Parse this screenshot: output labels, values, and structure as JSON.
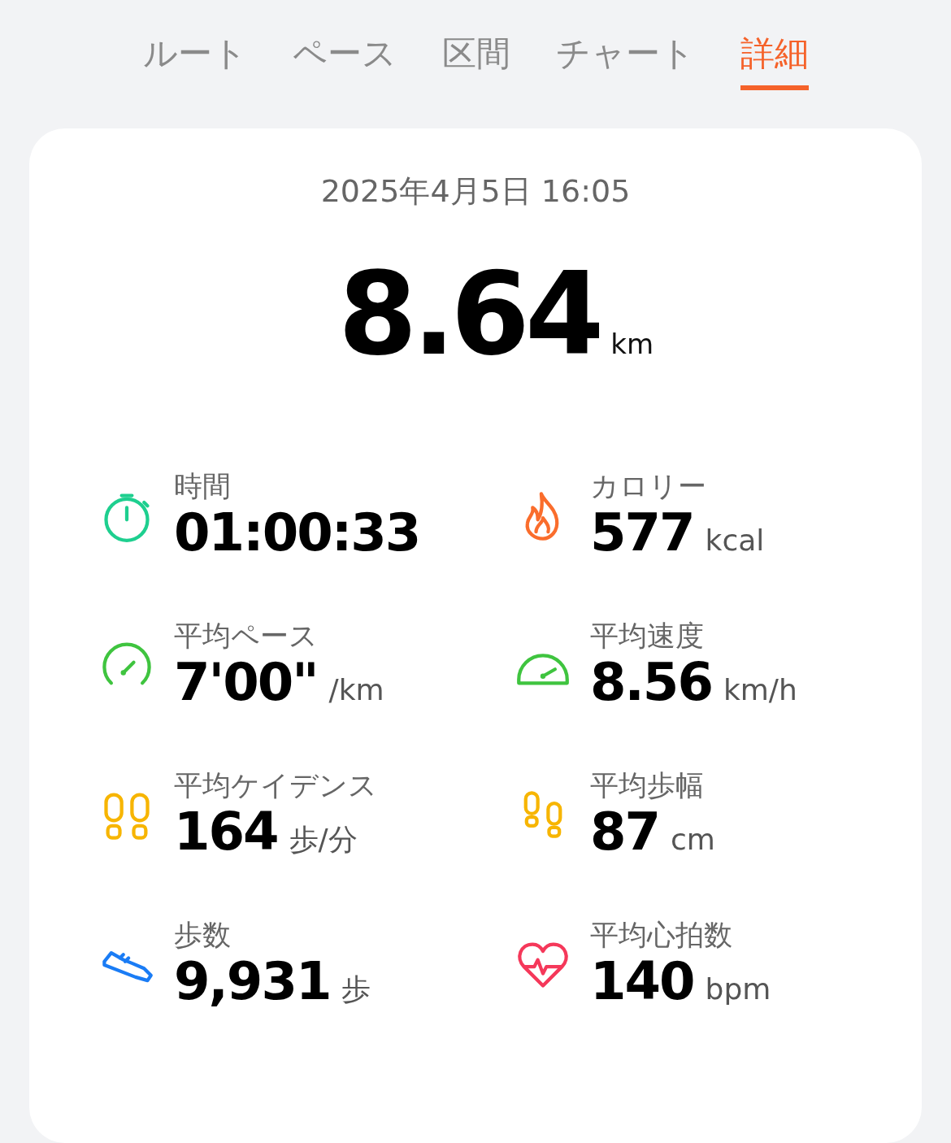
{
  "tabs": [
    {
      "label": "ルート",
      "selected": false
    },
    {
      "label": "ペース",
      "selected": false
    },
    {
      "label": "区間",
      "selected": false
    },
    {
      "label": "チャート",
      "selected": false
    },
    {
      "label": "詳細",
      "selected": true
    }
  ],
  "date": "2025年4月5日 16:05",
  "distance": {
    "value": "8.64",
    "unit": "km"
  },
  "stats": [
    {
      "kind": "stopwatch",
      "color": "#1ecf8f",
      "label": "時間",
      "value": "01:00:33"
    },
    {
      "kind": "flame",
      "color": "#fa6d2c",
      "label": "カロリー",
      "value": "577",
      "unit": "kcal"
    },
    {
      "kind": "gauge",
      "color": "#3fc43f",
      "label": "平均ペース",
      "value": "7'00\"",
      "unit": "/km"
    },
    {
      "kind": "speedometer",
      "color": "#3fc43f",
      "label": "平均速度",
      "value": "8.56",
      "unit": "km/h"
    },
    {
      "kind": "footprints",
      "color": "#f7b500",
      "label": "平均ケイデンス",
      "value": "164",
      "unit": "歩/分"
    },
    {
      "kind": "footprints-small",
      "color": "#f7b500",
      "label": "平均歩幅",
      "value": "87",
      "unit": "cm"
    },
    {
      "kind": "shoe",
      "color": "#1a7cf5",
      "label": "歩数",
      "value": "9,931",
      "unit": "歩"
    },
    {
      "kind": "heart",
      "color": "#f5385a",
      "label": "平均心拍数",
      "value": "140",
      "unit": "bpm"
    }
  ]
}
